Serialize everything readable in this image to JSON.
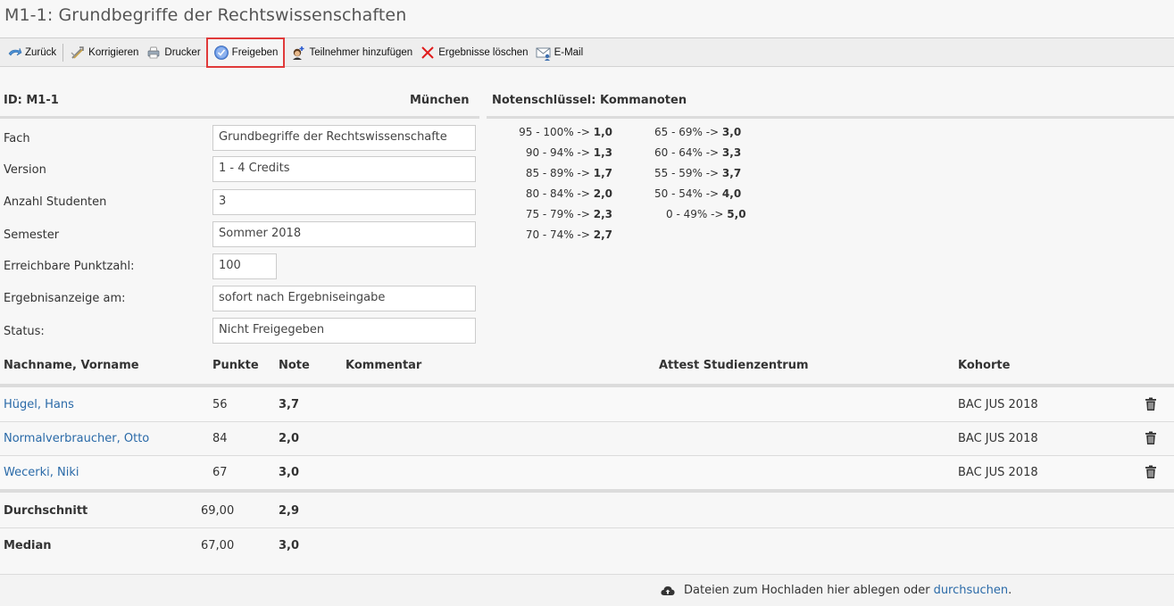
{
  "page": {
    "title": "M1-1: Grundbegriffe der Rechtswissenschaften"
  },
  "toolbar": {
    "back_label": "Zurück",
    "correct_label": "Korrigieren",
    "print_label": "Drucker",
    "release_label": "Freigeben",
    "add_participant_label": "Teilnehmer hinzufügen",
    "delete_results_label": "Ergebnisse löschen",
    "email_label": "E-Mail"
  },
  "info": {
    "id": "ID: M1-1",
    "location": "München",
    "grade_key_title": "Notenschlüssel: Kommanoten"
  },
  "form": {
    "subject_label": "Fach",
    "subject_value": "Grundbegriffe der Rechtswissenschafte",
    "version_label": "Version",
    "version_value": "1 - 4 Credits",
    "students_label": "Anzahl Studenten",
    "students_value": "3",
    "semester_label": "Semester",
    "semester_value": "Sommer 2018",
    "max_points_label": "Erreichbare Punktzahl:",
    "max_points_value": "100",
    "result_display_label": "Ergebnisanzeige am:",
    "result_display_value": "sofort nach Ergebniseingabe",
    "status_label": "Status:",
    "status_value": "Nicht Freigegeben"
  },
  "grade_key": {
    "col1": [
      {
        "range": "95 - 100% -> ",
        "grade": "1,0"
      },
      {
        "range": "90 - 94% -> ",
        "grade": "1,3"
      },
      {
        "range": "85 - 89% -> ",
        "grade": "1,7"
      },
      {
        "range": "80 - 84% -> ",
        "grade": "2,0"
      },
      {
        "range": "75 - 79% -> ",
        "grade": "2,3"
      },
      {
        "range": "70 - 74% -> ",
        "grade": "2,7"
      }
    ],
    "col2": [
      {
        "range": "65 - 69% -> ",
        "grade": "3,0"
      },
      {
        "range": "60 - 64% -> ",
        "grade": "3,3"
      },
      {
        "range": "55 - 59% -> ",
        "grade": "3,7"
      },
      {
        "range": "50 - 54% -> ",
        "grade": "4,0"
      },
      {
        "range": "0 - 49% -> ",
        "grade": "5,0"
      }
    ]
  },
  "table": {
    "headers": {
      "name": "Nachname, Vorname",
      "points": "Punkte",
      "grade": "Note",
      "comment": "Kommentar",
      "attest": "Attest Studienzentrum",
      "cohort": "Kohorte"
    },
    "rows": [
      {
        "name": "Hügel, Hans",
        "points": "56",
        "grade": "3,7",
        "cohort": "BAC JUS 2018"
      },
      {
        "name": "Normalverbraucher, Otto",
        "points": "84",
        "grade": "2,0",
        "cohort": "BAC JUS 2018"
      },
      {
        "name": "Wecerki, Niki",
        "points": "67",
        "grade": "3,0",
        "cohort": "BAC JUS 2018"
      }
    ],
    "average": {
      "label": "Durchschnitt",
      "points": "69,00",
      "grade": "2,9"
    },
    "median": {
      "label": "Median",
      "points": "67,00",
      "grade": "3,0"
    }
  },
  "footer": {
    "upload_text": "Dateien zum Hochladen hier ablegen oder",
    "browse_link": "durchsuchen",
    "period": "."
  },
  "colors": {
    "link": "#2a6aa8",
    "highlight": "#e03a3a"
  }
}
